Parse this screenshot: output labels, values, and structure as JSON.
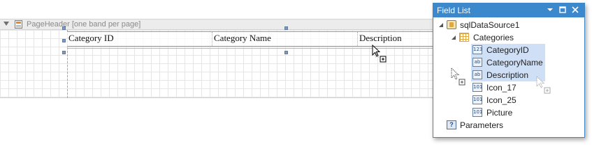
{
  "band": {
    "title": "PageHeader [one band per page]"
  },
  "table": {
    "cells": [
      "Category ID",
      "Category Name",
      "Description"
    ]
  },
  "field_list": {
    "title": "Field List",
    "buttons": {
      "dropdown": "▾",
      "maximize": "□",
      "close": "✕"
    },
    "datasource": "sqlDataSource1",
    "table": "Categories",
    "fields": [
      {
        "label": "CategoryID",
        "type_badge": "123",
        "selected": true
      },
      {
        "label": "CategoryName",
        "type_badge": "ab",
        "selected": true
      },
      {
        "label": "Description",
        "type_badge": "ab",
        "selected": true
      },
      {
        "label": "Icon_17",
        "type_badge": "101",
        "selected": false
      },
      {
        "label": "Icon_25",
        "type_badge": "101",
        "selected": false
      },
      {
        "label": "Picture",
        "type_badge": "101",
        "selected": false
      }
    ],
    "parameters": "Parameters",
    "parameters_badge": "?"
  },
  "colors": {
    "accent": "#3b89cc",
    "selection": "#cfe0f6",
    "grid": "#e6e6e6"
  }
}
